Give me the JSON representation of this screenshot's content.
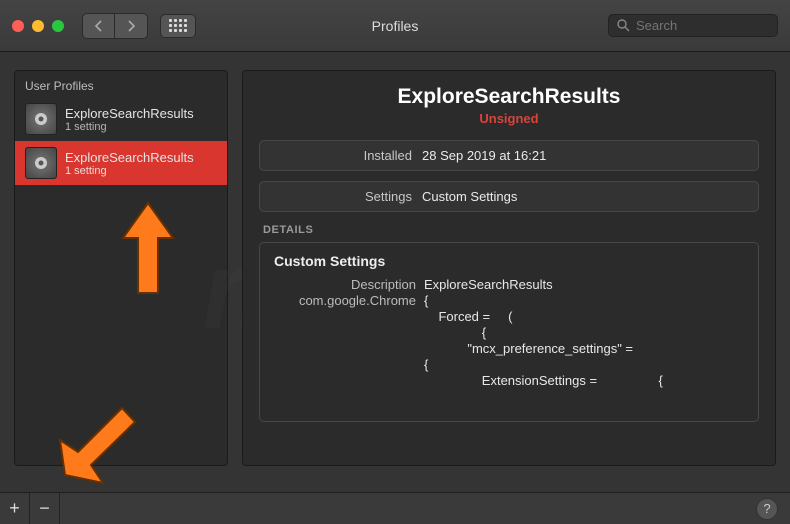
{
  "window": {
    "title": "Profiles"
  },
  "search": {
    "placeholder": "Search"
  },
  "sidebar": {
    "header": "User Profiles",
    "items": [
      {
        "name": "ExploreSearchResults",
        "sub": "1 setting"
      },
      {
        "name": "ExploreSearchResults",
        "sub": "1 setting"
      }
    ]
  },
  "profile": {
    "title": "ExploreSearchResults",
    "signed": "Unsigned",
    "installed_label": "Installed",
    "installed_value": "28 Sep 2019 at 16:21",
    "settings_label": "Settings",
    "settings_value": "Custom Settings"
  },
  "details": {
    "section_label": "DETAILS",
    "heading": "Custom Settings",
    "description_label": "Description",
    "description_value": "ExploreSearchResults",
    "domain_label": "com.google.Chrome",
    "lines": [
      "{",
      "    Forced =     (",
      "                {",
      "            \"mcx_preference_settings\" =",
      "{",
      "                ExtensionSettings =                 {"
    ]
  },
  "watermark": {
    "line1": "pc",
    "line2": "risk.com"
  }
}
